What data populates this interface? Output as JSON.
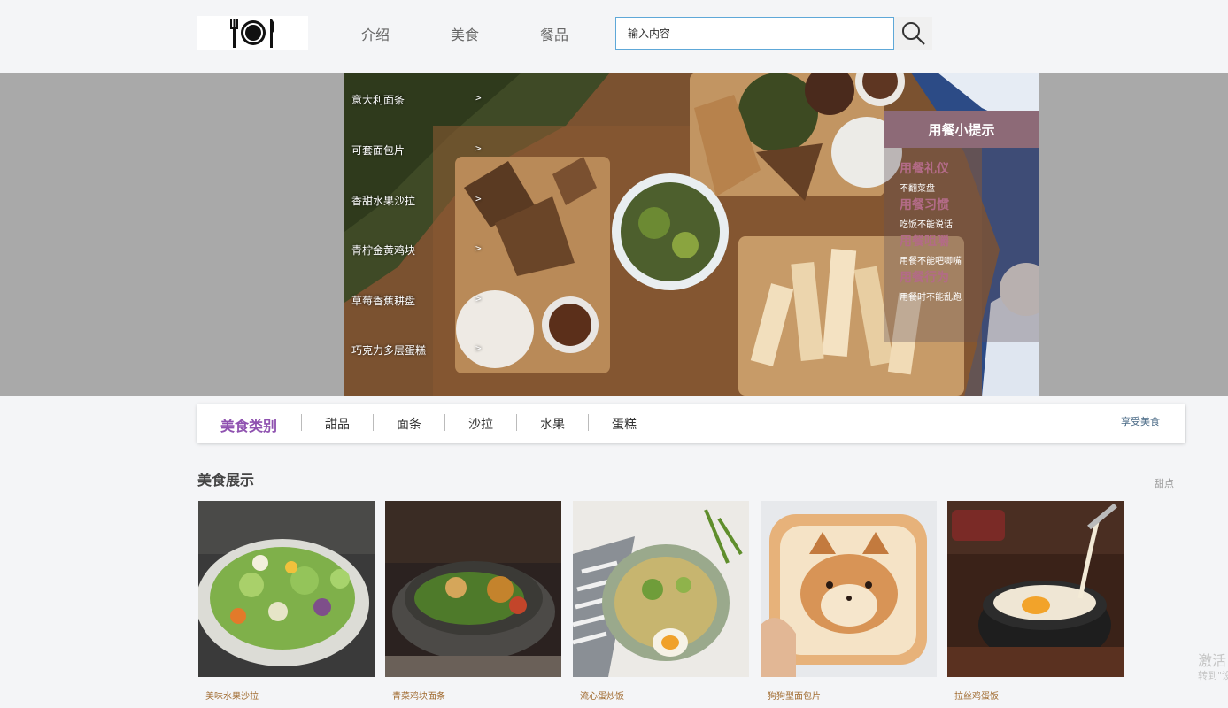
{
  "header": {
    "nav": [
      "介绍",
      "美食",
      "餐品"
    ],
    "search_value": "输入内容"
  },
  "banner": {
    "menu": [
      {
        "label": "意大利面条",
        "arrow": ">"
      },
      {
        "label": "可套面包片",
        "arrow": ">"
      },
      {
        "label": "香甜水果沙拉",
        "arrow": ">"
      },
      {
        "label": "青柠金黄鸡块",
        "arrow": ">"
      },
      {
        "label": "草莓香蕉耕盘",
        "arrow": ">"
      },
      {
        "label": "巧克力多层蛋糕",
        "arrow": ">"
      }
    ],
    "tips": {
      "title": "用餐小提示",
      "items": [
        {
          "title": "用餐礼仪",
          "text": "不翻菜盘"
        },
        {
          "title": "用餐习惯",
          "text": "吃饭不能说话"
        },
        {
          "title": "用餐咀嚼",
          "text": "用餐不能吧唧嘴"
        },
        {
          "title": "用餐行为",
          "text": "用餐时不能乱跑"
        }
      ]
    }
  },
  "categories": {
    "title": "美食类别",
    "items": [
      "甜品",
      "面条",
      "沙拉",
      "水果",
      "蛋糕"
    ],
    "right_link": "享受美食"
  },
  "showcase": {
    "title": "美食展示",
    "more": "甜点",
    "cards": [
      "美味水果沙拉",
      "青菜鸡块面条",
      "流心蛋炒饭",
      "狗狗型面包片",
      "拉丝鸡蛋饭"
    ]
  },
  "watermark": {
    "line1": "激活",
    "line2": "转到\"设"
  },
  "colors": {
    "accent_purple": "#8f52b0",
    "tips_header": "#8d6a77",
    "tip_title": "#b36b87",
    "caption": "#a06a2e",
    "search_border": "#5ea8d8"
  }
}
